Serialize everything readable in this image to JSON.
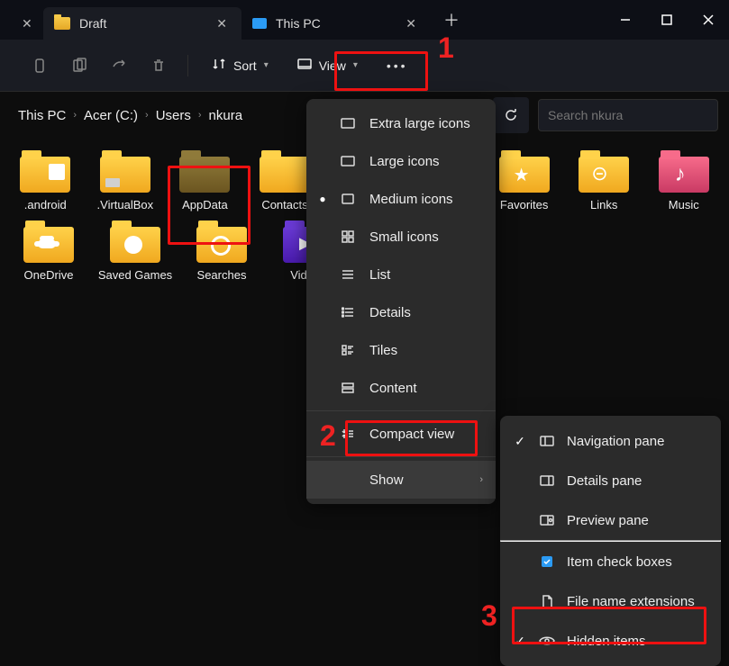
{
  "tabs": [
    {
      "label": "Draft",
      "icon": "folder"
    },
    {
      "label": "This PC",
      "icon": "monitor"
    }
  ],
  "toolbar": {
    "sort_label": "Sort",
    "view_label": "View"
  },
  "breadcrumbs": [
    "This PC",
    "Acer (C:)",
    "Users",
    "nkura"
  ],
  "search": {
    "placeholder": "Search nkura"
  },
  "folders_row1": [
    {
      "label": ".android",
      "icon": "data"
    },
    {
      "label": ".VirtualBox",
      "icon": "chip"
    },
    {
      "label": "AppData",
      "icon": "dim"
    },
    {
      "label": "Contacts",
      "icon": "plain"
    },
    {
      "label": "",
      "icon": ""
    },
    {
      "label": "",
      "icon": ""
    },
    {
      "label": "Favorites",
      "icon": "star"
    },
    {
      "label": "Links",
      "icon": "link"
    },
    {
      "label": "Music",
      "icon": "music"
    }
  ],
  "folders_row2": [
    {
      "label": "OneDrive",
      "icon": "cloud"
    },
    {
      "label": "Saved Games",
      "icon": "disk"
    },
    {
      "label": "Searches",
      "icon": "search"
    },
    {
      "label": "Videos",
      "icon": "video"
    }
  ],
  "view_menu": {
    "items": [
      {
        "label": "Extra large icons",
        "icon": "rect-lg",
        "bullet": false
      },
      {
        "label": "Large icons",
        "icon": "rect-lg",
        "bullet": false
      },
      {
        "label": "Medium icons",
        "icon": "rect-md",
        "bullet": true
      },
      {
        "label": "Small icons",
        "icon": "grid",
        "bullet": false
      },
      {
        "label": "List",
        "icon": "list",
        "bullet": false
      },
      {
        "label": "Details",
        "icon": "details",
        "bullet": false
      },
      {
        "label": "Tiles",
        "icon": "tiles",
        "bullet": false
      },
      {
        "label": "Content",
        "icon": "content",
        "bullet": false
      }
    ],
    "compact": "Compact view",
    "show": "Show"
  },
  "show_submenu": [
    {
      "label": "Navigation pane",
      "checked": true,
      "icon": "navpane"
    },
    {
      "label": "Details pane",
      "checked": false,
      "icon": "detpane"
    },
    {
      "label": "Preview pane",
      "checked": false,
      "icon": "prevpane"
    },
    {
      "label": "Item check boxes",
      "checked": false,
      "icon": "checkitem"
    },
    {
      "label": "File name extensions",
      "checked": false,
      "icon": "fileext"
    },
    {
      "label": "Hidden items",
      "checked": true,
      "icon": "eye"
    }
  ],
  "annotations": {
    "a1": "1",
    "a2": "2",
    "a3": "3"
  }
}
